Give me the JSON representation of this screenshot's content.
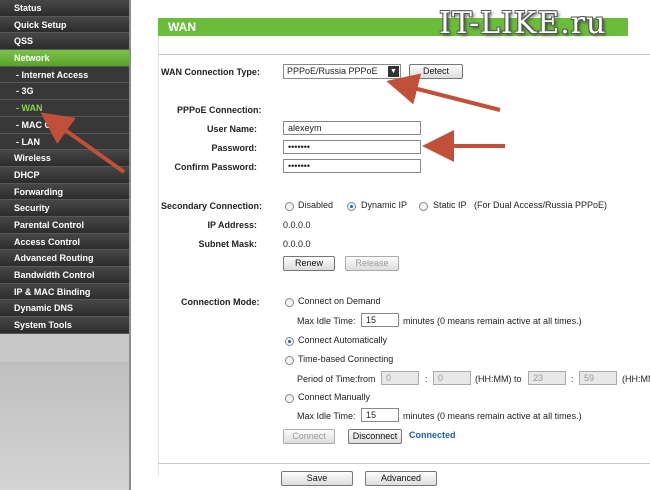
{
  "sidebar": {
    "items": [
      {
        "label": "Status"
      },
      {
        "label": "Quick Setup"
      },
      {
        "label": "QSS"
      },
      {
        "label": "Network"
      },
      {
        "label": "- Internet Access"
      },
      {
        "label": "- 3G"
      },
      {
        "label": "- WAN"
      },
      {
        "label": "- MAC Clone"
      },
      {
        "label": "- LAN"
      },
      {
        "label": "Wireless"
      },
      {
        "label": "DHCP"
      },
      {
        "label": "Forwarding"
      },
      {
        "label": "Security"
      },
      {
        "label": "Parental Control"
      },
      {
        "label": "Access Control"
      },
      {
        "label": "Advanced Routing"
      },
      {
        "label": "Bandwidth Control"
      },
      {
        "label": "IP & MAC Binding"
      },
      {
        "label": "Dynamic DNS"
      },
      {
        "label": "System Tools"
      }
    ]
  },
  "header": {
    "title": "WAN",
    "watermark": "IT-LIKE.ru"
  },
  "wan": {
    "type_label": "WAN Connection Type:",
    "type_value": "PPPoE/Russia PPPoE",
    "detect_label": "Detect"
  },
  "pppoe": {
    "section_label": "PPPoE Connection:",
    "username_label": "User Name:",
    "username_value": "alexeym",
    "password_label": "Password:",
    "password_value": "•••••••",
    "confirm_label": "Confirm Password:",
    "confirm_value": "•••••••"
  },
  "secondary": {
    "label": "Secondary Connection:",
    "options": [
      "Disabled",
      "Dynamic IP",
      "Static IP"
    ],
    "note": "(For Dual Access/Russia PPPoE)",
    "ip_label": "IP Address:",
    "ip_value": "0.0.0.0",
    "mask_label": "Subnet Mask:",
    "mask_value": "0.0.0.0",
    "renew_label": "Renew",
    "release_label": "Release"
  },
  "mode": {
    "label": "Connection Mode:",
    "on_demand": "Connect on Demand",
    "max_idle_label": "Max Idle Time:",
    "max_idle_value": "15",
    "minutes_note": "minutes (0 means remain active at all times.)",
    "automatic": "Connect Automatically",
    "time_based": "Time-based Connecting",
    "period_label": "Period of Time:from",
    "from_h": "0",
    "colon": ":",
    "from_m": "0",
    "hhmm_to": "(HH:MM) to",
    "to_h": "23",
    "to_m": "59",
    "hhmm": "(HH:MM)",
    "manual": "Connect Manually",
    "max_idle_value2": "15",
    "connect_label": "Connect",
    "disconnect_label": "Disconnect",
    "status": "Connected"
  },
  "footer": {
    "save_label": "Save",
    "advanced_label": "Advanced"
  },
  "colors": {
    "accent": "#6cbc3b",
    "sidebar_bg": "#333333",
    "arrow": "#c0503a",
    "status": "#1f5fa8"
  }
}
